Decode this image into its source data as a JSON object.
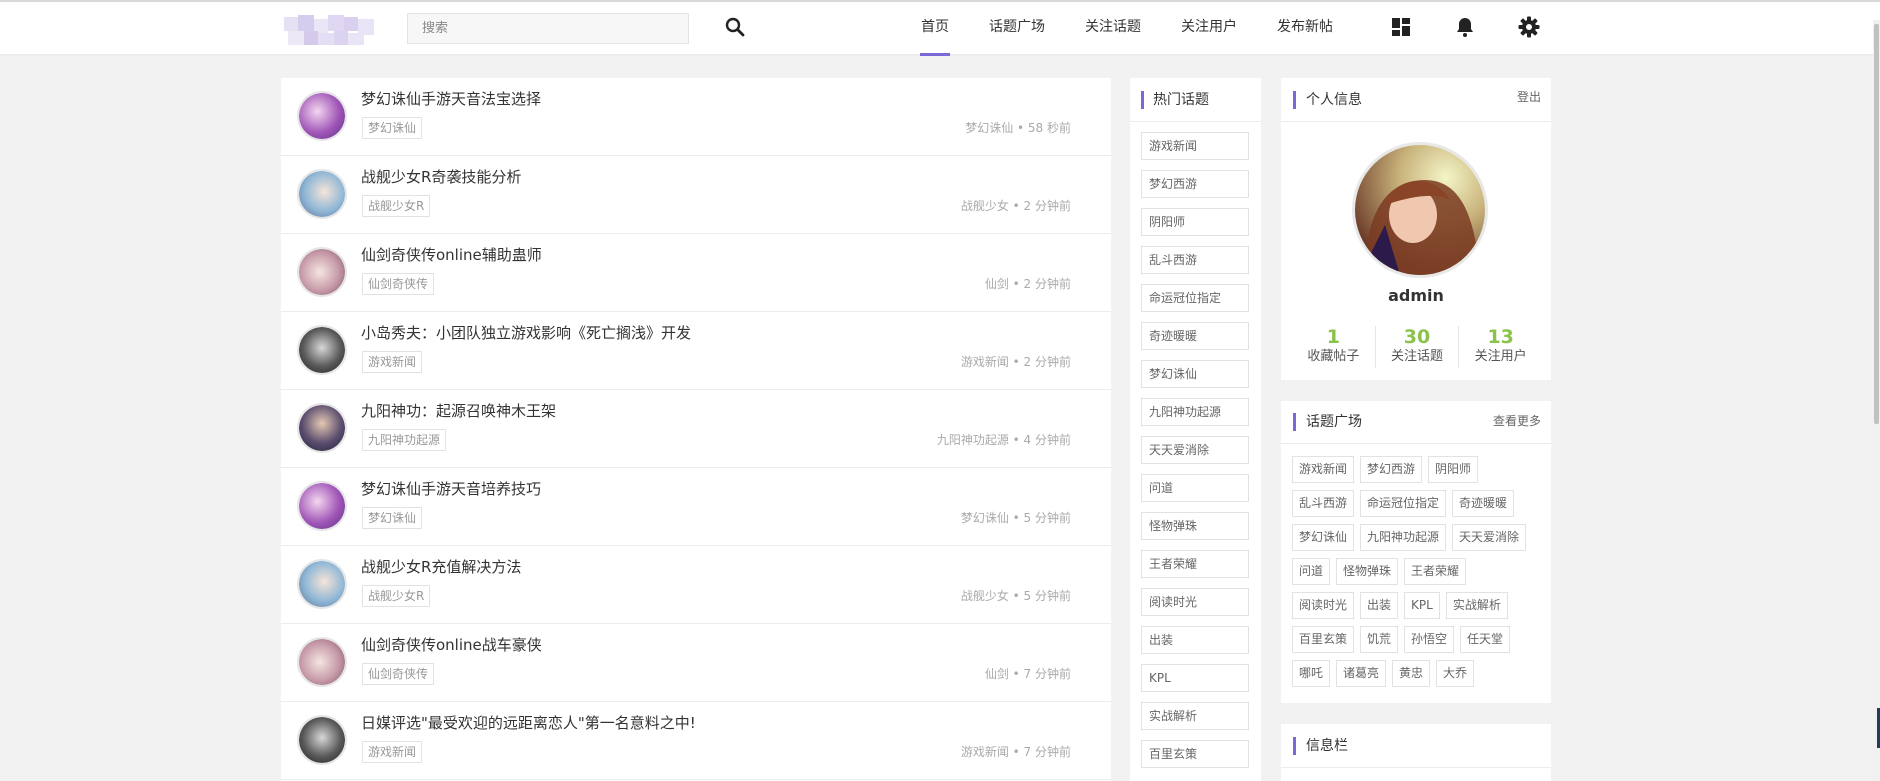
{
  "header": {
    "search": {
      "placeholder": "搜索"
    },
    "nav": [
      {
        "label": "首页",
        "active": true
      },
      {
        "label": "话题广场",
        "active": false
      },
      {
        "label": "关注话题",
        "active": false
      },
      {
        "label": "关注用户",
        "active": false
      },
      {
        "label": "发布新帖",
        "active": false
      }
    ],
    "icons": [
      "dashboard-icon",
      "bell-icon",
      "gear-icon"
    ]
  },
  "posts": [
    {
      "title": "梦幻诛仙手游天音法宝选择",
      "tag": "梦幻诛仙",
      "author": "梦幻诛仙",
      "time": "58 秒前",
      "meta": "梦幻诛仙 • 58 秒前"
    },
    {
      "title": "战舰少女R奇袭技能分析",
      "tag": "战舰少女R",
      "author": "战舰少女",
      "time": "2 分钟前",
      "meta": "战舰少女 • 2 分钟前"
    },
    {
      "title": "仙剑奇侠传online辅助蛊师",
      "tag": "仙剑奇侠传",
      "author": "仙剑",
      "time": "2 分钟前",
      "meta": "仙剑 • 2 分钟前"
    },
    {
      "title": "小岛秀夫：小团队独立游戏影响《死亡搁浅》开发",
      "tag": "游戏新闻",
      "author": "游戏新闻",
      "time": "2 分钟前",
      "meta": "游戏新闻 • 2 分钟前"
    },
    {
      "title": "九阳神功：起源召唤神木王架",
      "tag": "九阳神功起源",
      "author": "九阳神功起源",
      "time": "4 分钟前",
      "meta": "九阳神功起源 • 4 分钟前"
    },
    {
      "title": "梦幻诛仙手游天音培养技巧",
      "tag": "梦幻诛仙",
      "author": "梦幻诛仙",
      "time": "5 分钟前",
      "meta": "梦幻诛仙 • 5 分钟前"
    },
    {
      "title": "战舰少女R充值解决方法",
      "tag": "战舰少女R",
      "author": "战舰少女",
      "time": "5 分钟前",
      "meta": "战舰少女 • 5 分钟前"
    },
    {
      "title": "仙剑奇侠传online战车豪侠",
      "tag": "仙剑奇侠传",
      "author": "仙剑",
      "time": "7 分钟前",
      "meta": "仙剑 • 7 分钟前"
    },
    {
      "title": "日媒评选\"最受欢迎的远距离恋人\"第一名意料之中!",
      "tag": "游戏新闻",
      "author": "游戏新闻",
      "time": "7 分钟前",
      "meta": "游戏新闻 • 7 分钟前"
    }
  ],
  "hot_topics": {
    "title": "热门话题",
    "items": [
      "游戏新闻",
      "梦幻西游",
      "阴阳师",
      "乱斗西游",
      "命运冠位指定",
      "奇迹暖暖",
      "梦幻诛仙",
      "九阳神功起源",
      "天天爱消除",
      "问道",
      "怪物弹珠",
      "王者荣耀",
      "阅读时光",
      "出装",
      "KPL",
      "实战解析",
      "百里玄策"
    ]
  },
  "profile": {
    "title": "个人信息",
    "logout": "登出",
    "username": "admin",
    "stats": [
      {
        "value": "1",
        "label": "收藏帖子"
      },
      {
        "value": "30",
        "label": "关注话题"
      },
      {
        "value": "13",
        "label": "关注用户"
      }
    ]
  },
  "topic_square": {
    "title": "话题广场",
    "more": "查看更多",
    "tags": [
      "游戏新闻",
      "梦幻西游",
      "阴阳师",
      "乱斗西游",
      "命运冠位指定",
      "奇迹暖暖",
      "梦幻诛仙",
      "九阳神功起源",
      "天天爱消除",
      "问道",
      "怪物弹珠",
      "王者荣耀",
      "阅读时光",
      "出装",
      "KPL",
      "实战解析",
      "百里玄策",
      "饥荒",
      "孙悟空",
      "任天堂",
      "哪吒",
      "诸葛亮",
      "黄忠",
      "大乔"
    ]
  },
  "info_bar": {
    "title": "信息栏"
  },
  "colors": {
    "accent": "#7b68d6",
    "stat": "#8bc34a"
  }
}
